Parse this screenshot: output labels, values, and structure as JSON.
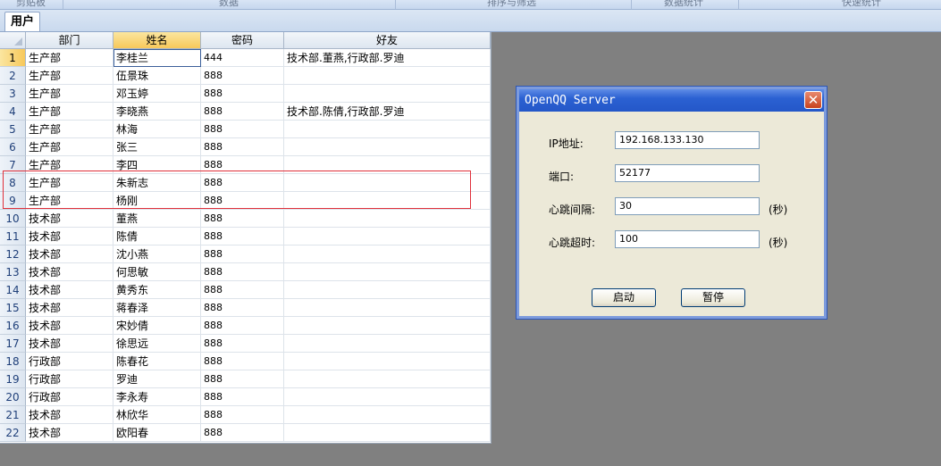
{
  "ribbon": {
    "groups": [
      "剪贴板",
      "数据",
      "排序与筛选",
      "数据统计",
      "快速统计"
    ]
  },
  "sheet": {
    "tab_label": "用户",
    "columns": [
      "部门",
      "姓名",
      "密码",
      "好友"
    ],
    "selected_column": 1,
    "selected_rows": [
      1
    ],
    "rows": [
      {
        "n": "1",
        "dept": "生产部",
        "name": "李桂兰",
        "pwd": "444",
        "friends": "技术部.董燕,行政部.罗迪"
      },
      {
        "n": "2",
        "dept": "生产部",
        "name": "伍景珠",
        "pwd": "888",
        "friends": ""
      },
      {
        "n": "3",
        "dept": "生产部",
        "name": "邓玉婷",
        "pwd": "888",
        "friends": ""
      },
      {
        "n": "4",
        "dept": "生产部",
        "name": "李晓燕",
        "pwd": "888",
        "friends": "技术部.陈倩,行政部.罗迪"
      },
      {
        "n": "5",
        "dept": "生产部",
        "name": "林海",
        "pwd": "888",
        "friends": ""
      },
      {
        "n": "6",
        "dept": "生产部",
        "name": "张三",
        "pwd": "888",
        "friends": ""
      },
      {
        "n": "7",
        "dept": "生产部",
        "name": "李四",
        "pwd": "888",
        "friends": ""
      },
      {
        "n": "8",
        "dept": "生产部",
        "name": "朱新志",
        "pwd": "888",
        "friends": ""
      },
      {
        "n": "9",
        "dept": "生产部",
        "name": "杨刚",
        "pwd": "888",
        "friends": ""
      },
      {
        "n": "10",
        "dept": "技术部",
        "name": "董燕",
        "pwd": "888",
        "friends": ""
      },
      {
        "n": "11",
        "dept": "技术部",
        "name": "陈倩",
        "pwd": "888",
        "friends": ""
      },
      {
        "n": "12",
        "dept": "技术部",
        "name": "沈小燕",
        "pwd": "888",
        "friends": ""
      },
      {
        "n": "13",
        "dept": "技术部",
        "name": "何思敏",
        "pwd": "888",
        "friends": ""
      },
      {
        "n": "14",
        "dept": "技术部",
        "name": "黄秀东",
        "pwd": "888",
        "friends": ""
      },
      {
        "n": "15",
        "dept": "技术部",
        "name": "蒋春泽",
        "pwd": "888",
        "friends": ""
      },
      {
        "n": "16",
        "dept": "技术部",
        "name": "宋妙倩",
        "pwd": "888",
        "friends": ""
      },
      {
        "n": "17",
        "dept": "技术部",
        "name": "徐思远",
        "pwd": "888",
        "friends": ""
      },
      {
        "n": "18",
        "dept": "行政部",
        "name": "陈春花",
        "pwd": "888",
        "friends": ""
      },
      {
        "n": "19",
        "dept": "行政部",
        "name": "罗迪",
        "pwd": "888",
        "friends": ""
      },
      {
        "n": "20",
        "dept": "行政部",
        "name": "李永寿",
        "pwd": "888",
        "friends": ""
      },
      {
        "n": "21",
        "dept": "技术部",
        "name": "林欣华",
        "pwd": "888",
        "friends": ""
      },
      {
        "n": "22",
        "dept": "技术部",
        "name": "欧阳春",
        "pwd": "888",
        "friends": ""
      }
    ]
  },
  "dialog": {
    "title": "OpenQQ Server",
    "ip_label": "IP地址:",
    "ip_value": "192.168.133.130",
    "port_label": "端口:",
    "port_value": "52177",
    "interval_label": "心跳间隔:",
    "interval_value": "30",
    "interval_unit": "(秒)",
    "timeout_label": "心跳超时:",
    "timeout_value": "100",
    "timeout_unit": "(秒)",
    "start_label": "启动",
    "pause_label": "暂停",
    "close_glyph": "✕"
  },
  "colors": {
    "highlight_box": "#e0303a",
    "selected_header": "#f7c85a",
    "titlebar": "#2b61d2"
  }
}
